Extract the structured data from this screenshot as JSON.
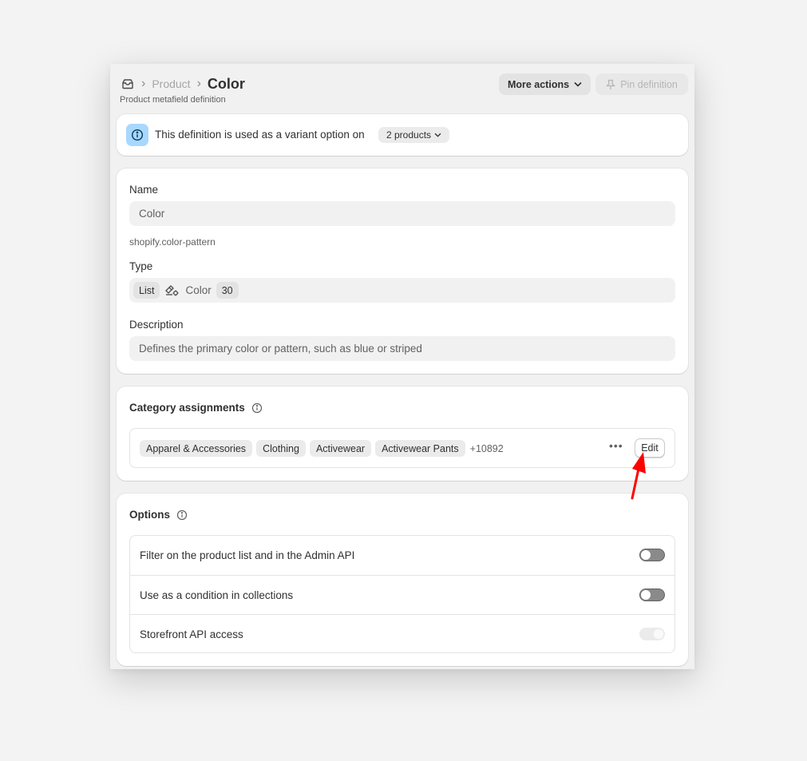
{
  "header": {
    "breadcrumb_parent": "Product",
    "breadcrumb_current": "Color",
    "subtitle": "Product metafield definition",
    "more_actions_label": "More actions",
    "pin_label": "Pin definition"
  },
  "banner": {
    "text": "This definition is used as a variant option on",
    "pill_label": "2 products"
  },
  "form": {
    "name_label": "Name",
    "name_value": "Color",
    "key": "shopify.color-pattern",
    "type_label": "Type",
    "type_list_chip": "List",
    "type_name": "Color",
    "type_count": "30",
    "description_label": "Description",
    "description_value": "Defines the primary color or pattern, such as blue or striped"
  },
  "category": {
    "title": "Category assignments",
    "tags": [
      "Apparel & Accessories",
      "Clothing",
      "Activewear",
      "Activewear Pants"
    ],
    "more_count": "+10892",
    "edit_label": "Edit"
  },
  "options": {
    "title": "Options",
    "rows": [
      {
        "label": "Filter on the product list and in the Admin API",
        "enabled": false
      },
      {
        "label": "Use as a condition in collections",
        "enabled": false
      },
      {
        "label": "Storefront API access",
        "enabled": true,
        "disabled": true
      }
    ]
  },
  "colors": {
    "accent_info": "#a8d8ff",
    "annotation_arrow": "#ff0000"
  },
  "icons": {
    "home": "metaobject-icon",
    "info": "info-icon",
    "pin": "pin-icon",
    "type": "color-type-icon",
    "chevron": "chevron-down-icon"
  }
}
